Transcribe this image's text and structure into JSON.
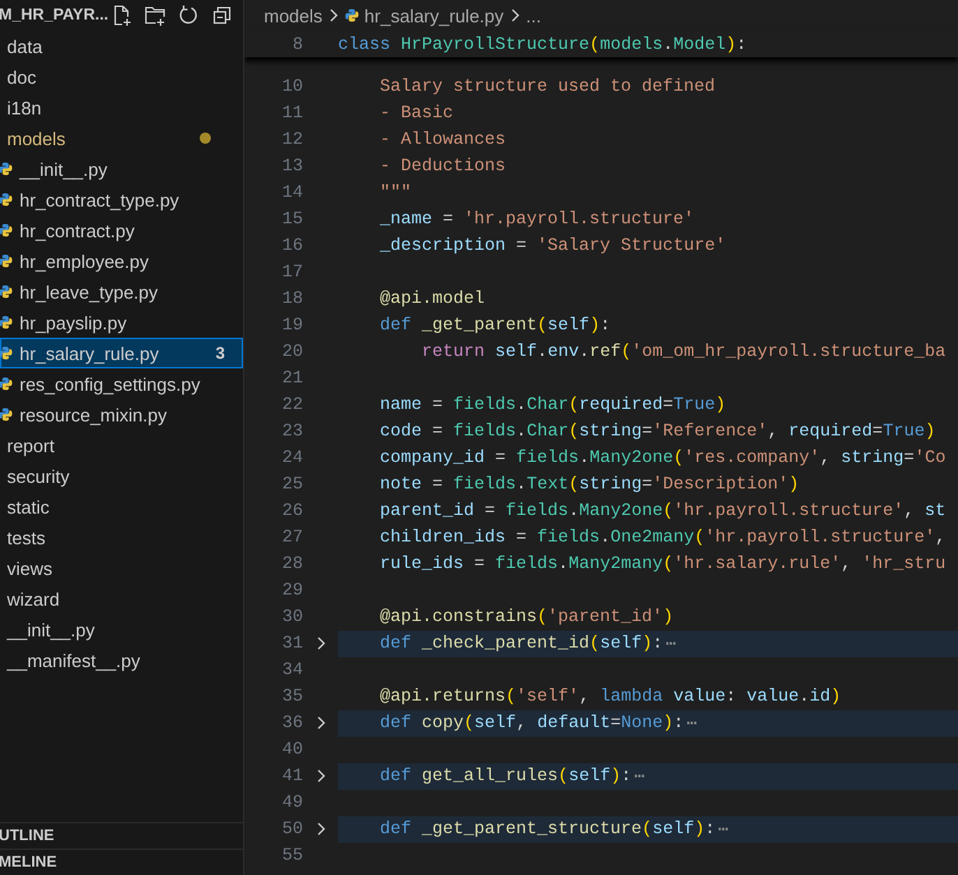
{
  "explorer": {
    "title": "M_HR_PAYR...",
    "tree": [
      {
        "label": "data",
        "selected": false,
        "modified": false
      },
      {
        "label": "doc",
        "selected": false,
        "modified": false
      },
      {
        "label": "i18n",
        "selected": false,
        "modified": false
      },
      {
        "label": "models",
        "selected": false,
        "modified": true,
        "children": [
          {
            "label": "__init__.py",
            "kind": "file",
            "selected": false,
            "modified": false
          },
          {
            "label": "hr_contract_type.py",
            "kind": "file",
            "selected": false,
            "modified": false
          },
          {
            "label": "hr_contract.py",
            "kind": "file",
            "selected": false,
            "modified": false
          },
          {
            "label": "hr_employee.py",
            "kind": "file",
            "selected": false,
            "modified": false
          },
          {
            "label": "hr_leave_type.py",
            "kind": "file",
            "selected": false,
            "modified": false
          },
          {
            "label": "hr_payslip.py",
            "kind": "file",
            "selected": false,
            "modified": false
          },
          {
            "label": "hr_salary_rule.py",
            "kind": "file",
            "selected": true,
            "modified": false,
            "badge": "3"
          },
          {
            "label": "res_config_settings.py",
            "kind": "file",
            "selected": false,
            "modified": false
          },
          {
            "label": "resource_mixin.py",
            "kind": "file",
            "selected": false,
            "modified": false
          }
        ]
      },
      {
        "label": "report",
        "selected": false,
        "modified": false
      },
      {
        "label": "security",
        "selected": false,
        "modified": false
      },
      {
        "label": "static",
        "selected": false,
        "modified": false
      },
      {
        "label": "tests",
        "selected": false,
        "modified": false
      },
      {
        "label": "views",
        "selected": false,
        "modified": false
      },
      {
        "label": "wizard",
        "selected": false,
        "modified": false
      },
      {
        "label": "__init__.py",
        "selected": false,
        "modified": false
      },
      {
        "label": "__manifest__.py",
        "selected": false,
        "modified": false
      }
    ],
    "sections": [
      "UTLINE",
      "MELINE"
    ]
  },
  "editor": {
    "breadcrumb": {
      "folder": "models",
      "file": "hr_salary_rule.py",
      "more": "..."
    },
    "sticky_line": {
      "number": "8",
      "tokens": [
        {
          "text": "class ",
          "kind": "keyword"
        },
        {
          "text": "HrPayrollStructure",
          "kind": "type"
        },
        {
          "text": "(",
          "kind": "bracket"
        },
        {
          "text": "models",
          "kind": "type"
        },
        {
          "text": ".",
          "kind": "plain"
        },
        {
          "text": "Model",
          "kind": "type"
        },
        {
          "text": ")",
          "kind": "bracket"
        },
        {
          "text": ":",
          "kind": "plain"
        }
      ]
    },
    "lines": [
      {
        "number": "10",
        "folded": false,
        "tokens": [
          {
            "text": "    Salary structure used to defined",
            "kind": "string"
          }
        ]
      },
      {
        "number": "11",
        "folded": false,
        "tokens": [
          {
            "text": "    - Basic",
            "kind": "string"
          }
        ]
      },
      {
        "number": "12",
        "folded": false,
        "tokens": [
          {
            "text": "    - Allowances",
            "kind": "string"
          }
        ]
      },
      {
        "number": "13",
        "folded": false,
        "tokens": [
          {
            "text": "    - Deductions",
            "kind": "string"
          }
        ]
      },
      {
        "number": "14",
        "folded": false,
        "tokens": [
          {
            "text": "    \"\"\"",
            "kind": "string"
          }
        ]
      },
      {
        "number": "15",
        "folded": false,
        "tokens": [
          {
            "text": "    _name",
            "kind": "variable"
          },
          {
            "text": " = ",
            "kind": "plain"
          },
          {
            "text": "'hr.payroll.structure'",
            "kind": "string"
          }
        ]
      },
      {
        "number": "16",
        "folded": false,
        "tokens": [
          {
            "text": "    _description",
            "kind": "variable"
          },
          {
            "text": " = ",
            "kind": "plain"
          },
          {
            "text": "'Salary Structure'",
            "kind": "string"
          }
        ]
      },
      {
        "number": "17",
        "folded": false
      },
      {
        "number": "18",
        "folded": false,
        "tokens": [
          {
            "text": "    @api.model",
            "kind": "function"
          }
        ]
      },
      {
        "number": "19",
        "folded": false,
        "tokens": [
          {
            "text": "    def ",
            "kind": "keyword"
          },
          {
            "text": "_get_parent",
            "kind": "function"
          },
          {
            "text": "(",
            "kind": "bracket"
          },
          {
            "text": "self",
            "kind": "variable"
          },
          {
            "text": ")",
            "kind": "bracket"
          },
          {
            "text": ":",
            "kind": "plain"
          }
        ]
      },
      {
        "number": "20",
        "folded": false,
        "tokens": [
          {
            "text": "        return ",
            "kind": "control"
          },
          {
            "text": "self",
            "kind": "variable"
          },
          {
            "text": ".",
            "kind": "plain"
          },
          {
            "text": "env",
            "kind": "variable"
          },
          {
            "text": ".",
            "kind": "plain"
          },
          {
            "text": "ref",
            "kind": "function"
          },
          {
            "text": "(",
            "kind": "bracket"
          },
          {
            "text": "'om_om_hr_payroll.structure_ba",
            "kind": "string"
          }
        ]
      },
      {
        "number": "21",
        "folded": false
      },
      {
        "number": "22",
        "folded": false,
        "tokens": [
          {
            "text": "    name",
            "kind": "variable"
          },
          {
            "text": " = ",
            "kind": "plain"
          },
          {
            "text": "fields",
            "kind": "type"
          },
          {
            "text": ".",
            "kind": "plain"
          },
          {
            "text": "Char",
            "kind": "type"
          },
          {
            "text": "(",
            "kind": "bracket"
          },
          {
            "text": "required",
            "kind": "variable"
          },
          {
            "text": "=",
            "kind": "plain"
          },
          {
            "text": "True",
            "kind": "keyword"
          },
          {
            "text": ")",
            "kind": "bracket"
          }
        ]
      },
      {
        "number": "23",
        "folded": false,
        "tokens": [
          {
            "text": "    code",
            "kind": "variable"
          },
          {
            "text": " = ",
            "kind": "plain"
          },
          {
            "text": "fields",
            "kind": "type"
          },
          {
            "text": ".",
            "kind": "plain"
          },
          {
            "text": "Char",
            "kind": "type"
          },
          {
            "text": "(",
            "kind": "bracket"
          },
          {
            "text": "string",
            "kind": "variable"
          },
          {
            "text": "=",
            "kind": "plain"
          },
          {
            "text": "'Reference'",
            "kind": "string"
          },
          {
            "text": ", ",
            "kind": "plain"
          },
          {
            "text": "required",
            "kind": "variable"
          },
          {
            "text": "=",
            "kind": "plain"
          },
          {
            "text": "True",
            "kind": "keyword"
          },
          {
            "text": ")",
            "kind": "bracket"
          }
        ]
      },
      {
        "number": "24",
        "folded": false,
        "tokens": [
          {
            "text": "    company_id",
            "kind": "variable"
          },
          {
            "text": " = ",
            "kind": "plain"
          },
          {
            "text": "fields",
            "kind": "type"
          },
          {
            "text": ".",
            "kind": "plain"
          },
          {
            "text": "Many2one",
            "kind": "type"
          },
          {
            "text": "(",
            "kind": "bracket"
          },
          {
            "text": "'res.company'",
            "kind": "string"
          },
          {
            "text": ", ",
            "kind": "plain"
          },
          {
            "text": "string",
            "kind": "variable"
          },
          {
            "text": "=",
            "kind": "plain"
          },
          {
            "text": "'Co",
            "kind": "string"
          }
        ]
      },
      {
        "number": "25",
        "folded": false,
        "tokens": [
          {
            "text": "    note",
            "kind": "variable"
          },
          {
            "text": " = ",
            "kind": "plain"
          },
          {
            "text": "fields",
            "kind": "type"
          },
          {
            "text": ".",
            "kind": "plain"
          },
          {
            "text": "Text",
            "kind": "type"
          },
          {
            "text": "(",
            "kind": "bracket"
          },
          {
            "text": "string",
            "kind": "variable"
          },
          {
            "text": "=",
            "kind": "plain"
          },
          {
            "text": "'Description'",
            "kind": "string"
          },
          {
            "text": ")",
            "kind": "bracket"
          }
        ]
      },
      {
        "number": "26",
        "folded": false,
        "tokens": [
          {
            "text": "    parent_id",
            "kind": "variable"
          },
          {
            "text": " = ",
            "kind": "plain"
          },
          {
            "text": "fields",
            "kind": "type"
          },
          {
            "text": ".",
            "kind": "plain"
          },
          {
            "text": "Many2one",
            "kind": "type"
          },
          {
            "text": "(",
            "kind": "bracket"
          },
          {
            "text": "'hr.payroll.structure'",
            "kind": "string"
          },
          {
            "text": ", ",
            "kind": "plain"
          },
          {
            "text": "st",
            "kind": "variable"
          }
        ]
      },
      {
        "number": "27",
        "folded": false,
        "tokens": [
          {
            "text": "    children_ids",
            "kind": "variable"
          },
          {
            "text": " = ",
            "kind": "plain"
          },
          {
            "text": "fields",
            "kind": "type"
          },
          {
            "text": ".",
            "kind": "plain"
          },
          {
            "text": "One2many",
            "kind": "type"
          },
          {
            "text": "(",
            "kind": "bracket"
          },
          {
            "text": "'hr.payroll.structure'",
            "kind": "string"
          },
          {
            "text": ",",
            "kind": "plain"
          }
        ]
      },
      {
        "number": "28",
        "folded": false,
        "tokens": [
          {
            "text": "    rule_ids",
            "kind": "variable"
          },
          {
            "text": " = ",
            "kind": "plain"
          },
          {
            "text": "fields",
            "kind": "type"
          },
          {
            "text": ".",
            "kind": "plain"
          },
          {
            "text": "Many2many",
            "kind": "type"
          },
          {
            "text": "(",
            "kind": "bracket"
          },
          {
            "text": "'hr.salary.rule'",
            "kind": "string"
          },
          {
            "text": ", ",
            "kind": "plain"
          },
          {
            "text": "'hr_stru",
            "kind": "string"
          }
        ]
      },
      {
        "number": "29",
        "folded": false
      },
      {
        "number": "30",
        "folded": false,
        "tokens": [
          {
            "text": "    @api.constrains",
            "kind": "function"
          },
          {
            "text": "(",
            "kind": "bracket"
          },
          {
            "text": "'parent_id'",
            "kind": "string"
          },
          {
            "text": ")",
            "kind": "bracket"
          }
        ]
      },
      {
        "number": "31",
        "folded": true,
        "ellipsis": "⋯",
        "tokens": [
          {
            "text": "    def ",
            "kind": "keyword"
          },
          {
            "text": "_check_parent_id",
            "kind": "function"
          },
          {
            "text": "(",
            "kind": "bracket"
          },
          {
            "text": "self",
            "kind": "variable"
          },
          {
            "text": ")",
            "kind": "bracket"
          },
          {
            "text": ":",
            "kind": "plain"
          }
        ]
      },
      {
        "number": "34",
        "folded": false
      },
      {
        "number": "35",
        "folded": false,
        "tokens": [
          {
            "text": "    @api.returns",
            "kind": "function"
          },
          {
            "text": "(",
            "kind": "bracket"
          },
          {
            "text": "'self'",
            "kind": "string"
          },
          {
            "text": ", ",
            "kind": "plain"
          },
          {
            "text": "lambda ",
            "kind": "keyword"
          },
          {
            "text": "value",
            "kind": "variable"
          },
          {
            "text": ": ",
            "kind": "plain"
          },
          {
            "text": "value",
            "kind": "variable"
          },
          {
            "text": ".",
            "kind": "plain"
          },
          {
            "text": "id",
            "kind": "variable"
          },
          {
            "text": ")",
            "kind": "bracket"
          }
        ]
      },
      {
        "number": "36",
        "folded": true,
        "ellipsis": "⋯",
        "tokens": [
          {
            "text": "    def ",
            "kind": "keyword"
          },
          {
            "text": "copy",
            "kind": "function"
          },
          {
            "text": "(",
            "kind": "bracket"
          },
          {
            "text": "self",
            "kind": "variable"
          },
          {
            "text": ", ",
            "kind": "plain"
          },
          {
            "text": "default",
            "kind": "variable"
          },
          {
            "text": "=",
            "kind": "plain"
          },
          {
            "text": "None",
            "kind": "keyword"
          },
          {
            "text": ")",
            "kind": "bracket"
          },
          {
            "text": ":",
            "kind": "plain"
          }
        ]
      },
      {
        "number": "40",
        "folded": false
      },
      {
        "number": "41",
        "folded": true,
        "ellipsis": "⋯",
        "tokens": [
          {
            "text": "    def ",
            "kind": "keyword"
          },
          {
            "text": "get_all_rules",
            "kind": "function"
          },
          {
            "text": "(",
            "kind": "bracket"
          },
          {
            "text": "self",
            "kind": "variable"
          },
          {
            "text": ")",
            "kind": "bracket"
          },
          {
            "text": ":",
            "kind": "plain"
          }
        ]
      },
      {
        "number": "49",
        "folded": false
      },
      {
        "number": "50",
        "folded": true,
        "ellipsis": "⋯",
        "tokens": [
          {
            "text": "    def ",
            "kind": "keyword"
          },
          {
            "text": "_get_parent_structure",
            "kind": "function"
          },
          {
            "text": "(",
            "kind": "bracket"
          },
          {
            "text": "self",
            "kind": "variable"
          },
          {
            "text": ")",
            "kind": "bracket"
          },
          {
            "text": ":",
            "kind": "plain"
          }
        ]
      },
      {
        "number": "55",
        "folded": false
      }
    ]
  }
}
